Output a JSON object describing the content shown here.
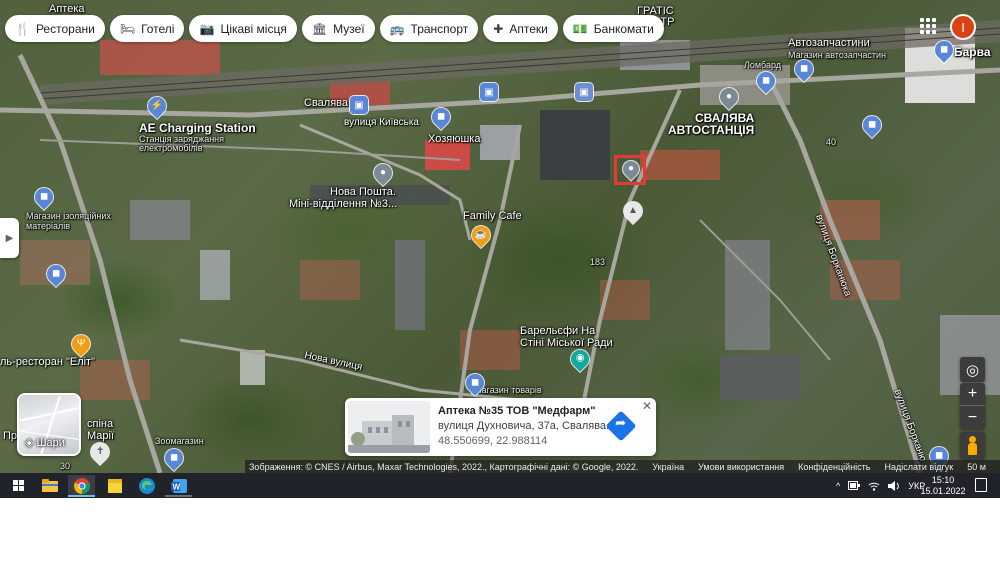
{
  "chips": [
    {
      "label": "Ресторани",
      "icon": "fork-knife-icon",
      "glyph": "🍴"
    },
    {
      "label": "Готелі",
      "icon": "bed-icon",
      "glyph": "🛏"
    },
    {
      "label": "Цікаві місця",
      "icon": "camera-icon",
      "glyph": "📷"
    },
    {
      "label": "Музеї",
      "icon": "museum-icon",
      "glyph": "🏛"
    },
    {
      "label": "Транспорт",
      "icon": "bus-icon",
      "glyph": "🚌"
    },
    {
      "label": "Аптеки",
      "icon": "pharmacy-icon",
      "glyph": "✚"
    },
    {
      "label": "Банкомати",
      "icon": "atm-icon",
      "glyph": "💵"
    }
  ],
  "account": {
    "initial": "І",
    "color": "#d84315"
  },
  "side_toggle_glyph": "▶",
  "map": {
    "labels": {
      "gratis": "ГРАТІС",
      "center": "ЦЕНТР",
      "apteka_top": "Аптека",
      "avtozapchastyny": "Автозапчастини",
      "avtozapchastyny_sub": "Магазин автозапчастин",
      "lombard": "Ломбард",
      "barva": "Барва",
      "svaliava": "Свалява",
      "kyivska": "вулиця Київська",
      "charging": "AE Charging Station",
      "charging_sub1": "Станція заряджання",
      "charging_sub2": "електромобілів",
      "hoziaiushka": "Хозяюшка",
      "avtostantsiia1": "СВАЛЯВА",
      "avtostantsiia2": "АВТОСТАНЦІЯ",
      "nova_poshta1": "Нова Пошта.",
      "nova_poshta2": "Міні-відділення №3...",
      "family_cafe": "Family Cafe",
      "izoliatsiini1": "Магазин ізоляційних",
      "izoliatsiini2": "матеріалів",
      "borkaniuka": "вулиця Борканюка",
      "barelefy1": "Барельєфи На",
      "barelefy2": "Стіні Міської Ради",
      "num_183": "183",
      "num_40": "40",
      "num_30": "30",
      "nova_vul": "Нова вулиця",
      "elit": "ль-ресторан \"Еліт\"",
      "spina1": "спіна",
      "spina2": "Марії",
      "pr": "Пр",
      "magazyn_tovariv": "Магазин товарів",
      "zoomahazyn": "Зоомагазин",
      "borkaniuka2": "вулиця Борканю"
    }
  },
  "layers": {
    "label": "Шари"
  },
  "controls": {
    "zoom_in": "+",
    "zoom_out": "−",
    "locate": "◎"
  },
  "card": {
    "title": "Аптека №35 ТОВ \"Медфарм\"",
    "address": "вулиця Духновича, 37а, Свалява...",
    "coords": "48.550699, 22.988114",
    "close": "✕",
    "directions_glyph": "➦"
  },
  "attribution": {
    "imagery": "Зображення: © CNES / Airbus, Maxar Technologies, 2022., Картографічні дані: © Google, 2022.",
    "country": "Україна",
    "terms": "Умови використання",
    "privacy": "Конфіденційність",
    "feedback": "Надіслати відгук",
    "scale": "50 м"
  },
  "taskbar": {
    "tray_chevron": "^",
    "language": "УКР",
    "time": "15:10",
    "date": "15.01.2022",
    "accent": "#76b9ed"
  }
}
